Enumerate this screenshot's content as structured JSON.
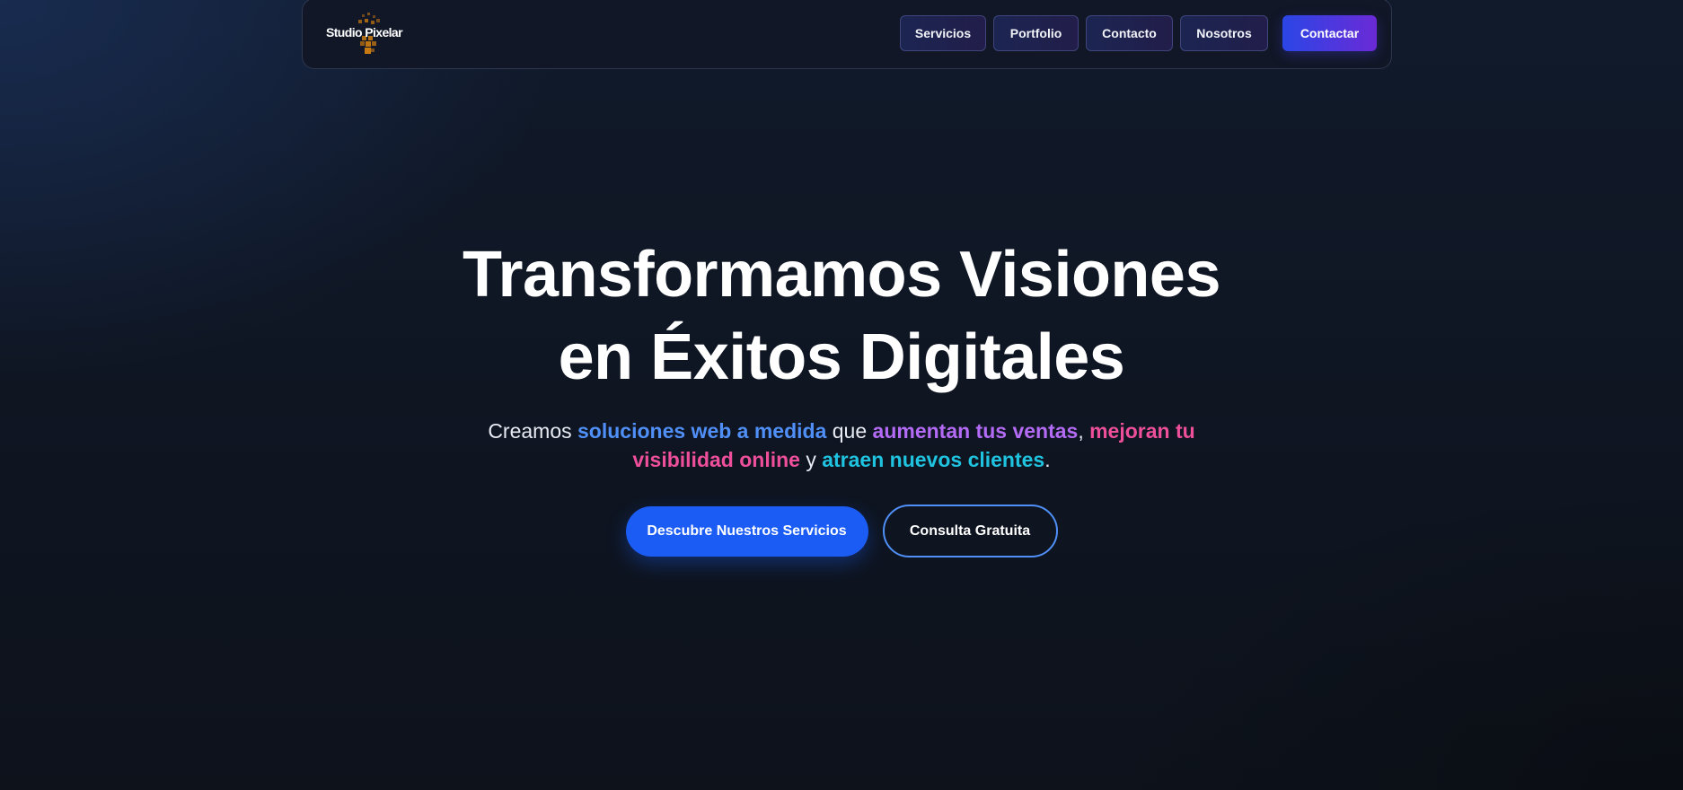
{
  "navbar": {
    "logo_text": "Studio Pixelar",
    "links": [
      {
        "label": "Servicios"
      },
      {
        "label": "Portfolio"
      },
      {
        "label": "Contacto"
      },
      {
        "label": "Nosotros"
      }
    ],
    "cta_label": "Contactar"
  },
  "hero": {
    "title_line1": "Transformamos Visiones",
    "title_line2": "en Éxitos Digitales",
    "subtitle": {
      "t1": "Creamos ",
      "h1": "soluciones web a medida",
      "t2": " que ",
      "h2": "aumentan tus ventas",
      "t3": ", ",
      "h3": "mejoran tu visibilidad online",
      "t4": " y ",
      "h4": "atraen nuevos clientes",
      "t5": "."
    },
    "primary_button": "Descubre Nuestros Servicios",
    "secondary_button": "Consulta Gratuita"
  },
  "colors": {
    "background": "#0f1623",
    "accent_blue": "#4f8ff7",
    "accent_purple": "#b36bf5",
    "accent_pink": "#ee4f9b",
    "accent_cyan": "#1fc3df",
    "primary_button": "#1b5cf5",
    "cta_gradient_start": "#2b46e6",
    "cta_gradient_end": "#6a2ad6",
    "logo_pixels": "#c77a12"
  }
}
